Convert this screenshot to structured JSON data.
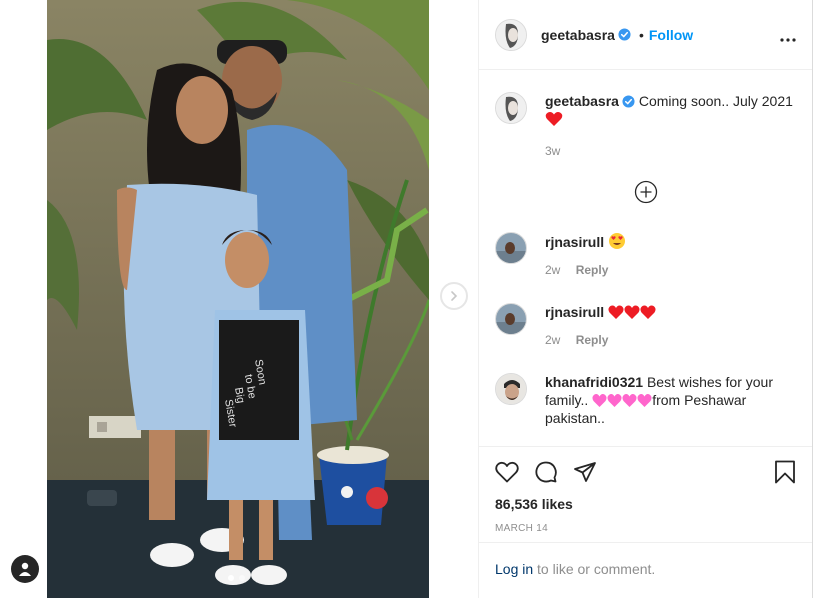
{
  "post": {
    "username": "geetabasra",
    "follow_label": "Follow",
    "dot": "•",
    "caption_text": "Coming soon.. July 2021",
    "caption_time": "3w",
    "photo_shirt_text": [
      "Soon",
      "to be",
      "Big",
      "Sister"
    ]
  },
  "comments": [
    {
      "username": "rjnasirull",
      "text": "",
      "emoji": "heart-eyes",
      "time": "2w",
      "reply_label": "Reply"
    },
    {
      "username": "rjnasirull",
      "text": "",
      "emoji": "three-red-hearts",
      "time": "2w",
      "reply_label": "Reply"
    },
    {
      "username": "khanafridi0321",
      "text_before": "Best wishes for your family..",
      "text_after": "from Peshawar pakistan..",
      "emoji": "four-pink-hearts"
    }
  ],
  "actions": {
    "likes": "86,536 likes",
    "date": "MARCH 14"
  },
  "login": {
    "link": "Log in",
    "text": " to like or comment."
  },
  "colors": {
    "link_blue": "#0095f6",
    "dark_link": "#00376b",
    "verified": "#3897f0",
    "heart_red": "#ed1c24",
    "heart_pink": "#ff66cc"
  }
}
